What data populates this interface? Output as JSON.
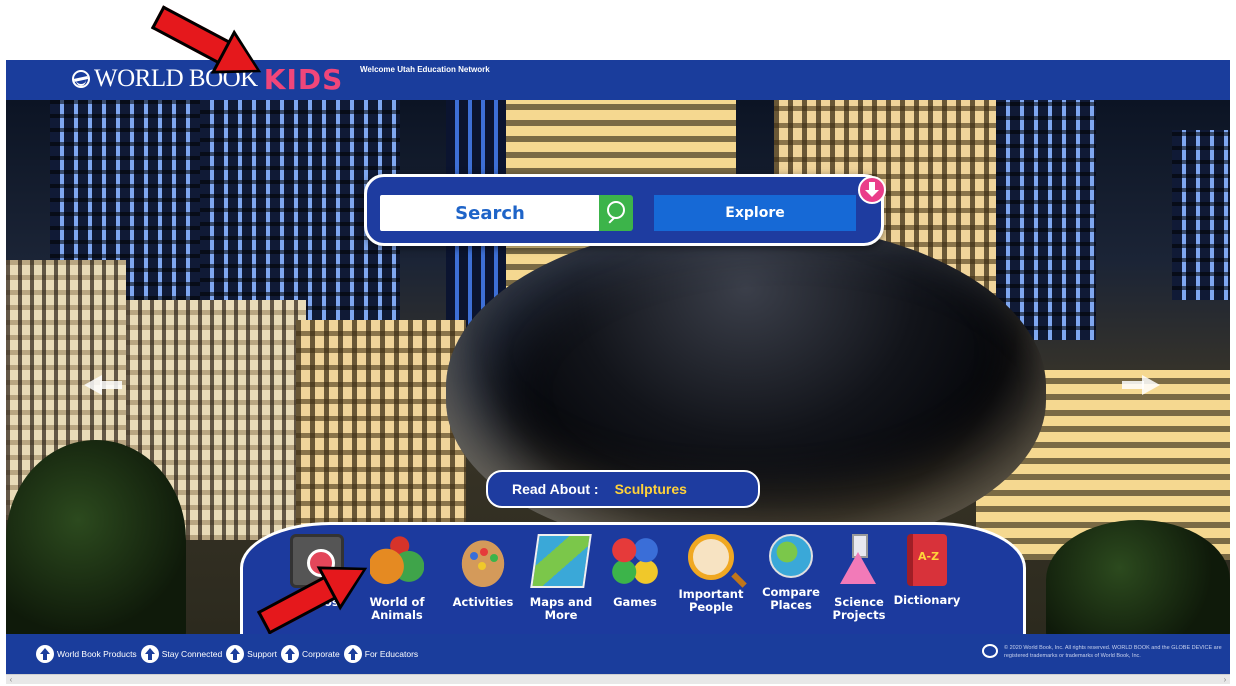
{
  "header": {
    "logo_text": "WORLD BOOK",
    "logo_kids": "KIDS",
    "welcome": "Welcome Utah Education Network"
  },
  "search": {
    "placeholder": "Search",
    "explore_label": "Explore"
  },
  "read_about": {
    "label": "Read About :",
    "topic": "Sculptures"
  },
  "tools": [
    {
      "label": "Videos",
      "icon": "video-camera-icon"
    },
    {
      "label": "World of Animals",
      "icon": "animals-icon"
    },
    {
      "label": "Activities",
      "icon": "paint-palette-icon"
    },
    {
      "label": "Maps and More",
      "icon": "map-icon"
    },
    {
      "label": "Games",
      "icon": "puzzle-icon"
    },
    {
      "label": "Important People",
      "icon": "magnifier-person-icon"
    },
    {
      "label": "Compare Places",
      "icon": "globe-icon"
    },
    {
      "label": "Science Projects",
      "icon": "flask-icon"
    },
    {
      "label": "Dictionary",
      "icon": "book-az-icon"
    }
  ],
  "footer": {
    "links": [
      "World Book Products",
      "Stay Connected",
      "Support",
      "Corporate",
      "For Educators"
    ],
    "copyright": "© 2020 World Book, Inc. All rights reserved. WORLD BOOK and the GLOBE DEVICE are registered trademarks or trademarks of World Book, Inc."
  },
  "colors": {
    "header_blue": "#1a3d9c",
    "kids_pink": "#f0467a",
    "search_green": "#3cb44a",
    "explore_blue": "#1669d6",
    "highlight_yellow": "#ffd23a",
    "annotation_red": "#e5181c"
  }
}
